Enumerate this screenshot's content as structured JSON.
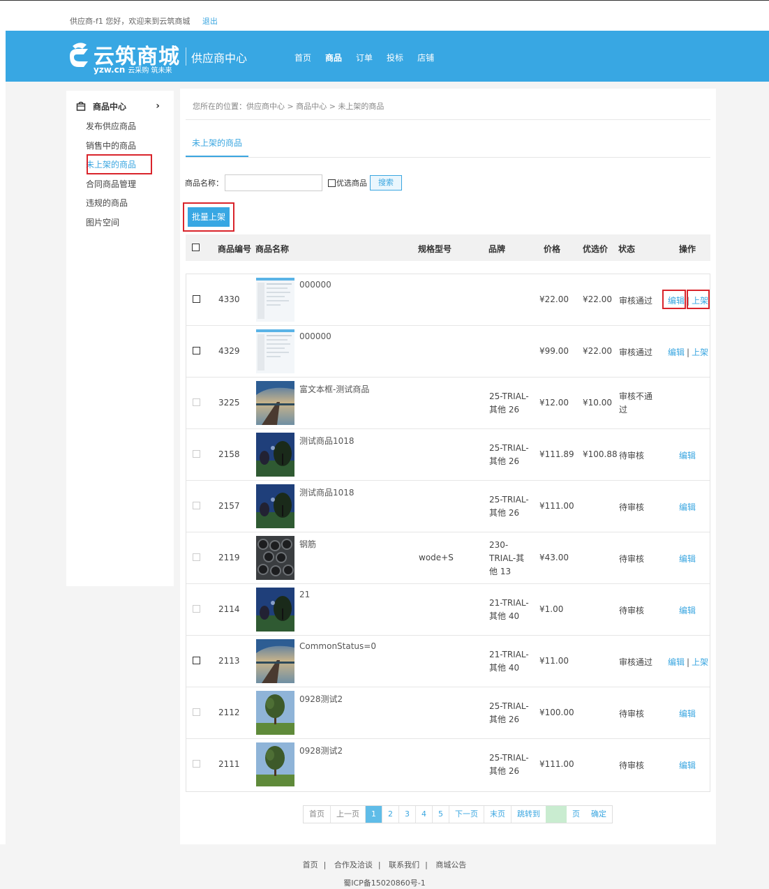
{
  "topbar": {
    "welcome": "供应商-f1 您好，欢迎来到云筑商城",
    "logout": "退出"
  },
  "header": {
    "logo_main": "云筑商城",
    "logo_domain": "yzw.cn",
    "logo_slogan": "云采购 筑未来",
    "title": "供应商中心",
    "nav": [
      "首页",
      "商品",
      "订单",
      "投标",
      "店铺"
    ],
    "brand_color": "#38a7e3"
  },
  "sidebar": {
    "heading": "商品中心",
    "items": [
      "发布供应商品",
      "销售中的商品",
      "未上架的商品",
      "合同商品管理",
      "违规的商品",
      "图片空间"
    ],
    "active_index": 2
  },
  "main": {
    "breadcrumb": "您所在的位置：供应商中心 > 商品中心 > 未上架的商品",
    "tab": "未上架的商品",
    "search": {
      "label": "商品名称：",
      "value": "",
      "checkbox_label": "优选商品",
      "button": "搜索"
    },
    "batch_button": "批量上架",
    "columns": [
      "商品编号",
      "商品名称",
      "规格型号",
      "品牌",
      "价格",
      "优选价",
      "状态",
      "操作"
    ],
    "rows": [
      {
        "id": "4330",
        "name": "000000",
        "spec": "",
        "brand": "",
        "price": "¥22.00",
        "preferred": "¥22.00",
        "status": "审核通过",
        "edit": "编辑",
        "shelf": "上架",
        "thumb": "screenshot",
        "checkable": true
      },
      {
        "id": "4329",
        "name": "000000",
        "spec": "",
        "brand": "",
        "price": "¥99.00",
        "preferred": "¥22.00",
        "status": "审核通过",
        "edit": "编辑",
        "shelf": "上架",
        "thumb": "screenshot",
        "checkable": true
      },
      {
        "id": "3225",
        "name": "富文本框-测试商品",
        "spec": "",
        "brand": "25-TRIAL-其他 26",
        "price": "¥12.00",
        "preferred": "¥10.00",
        "status": "审核不通过",
        "edit": "",
        "shelf": "",
        "thumb": "pier",
        "checkable": false
      },
      {
        "id": "2158",
        "name": "测试商品1018",
        "spec": "",
        "brand": "25-TRIAL-其他 26",
        "price": "¥111.89",
        "preferred": "¥100.88",
        "status": "待审核",
        "edit": "编辑",
        "shelf": "",
        "thumb": "trees",
        "checkable": false
      },
      {
        "id": "2157",
        "name": "测试商品1018",
        "spec": "",
        "brand": "25-TRIAL-其他 26",
        "price": "¥111.00",
        "preferred": "",
        "status": "待审核",
        "edit": "编辑",
        "shelf": "",
        "thumb": "trees",
        "checkable": false
      },
      {
        "id": "2119",
        "name": "钢筋",
        "spec": "wode+S",
        "brand": "230-TRIAL-其他 13",
        "price": "¥43.00",
        "preferred": "",
        "status": "待审核",
        "edit": "编辑",
        "shelf": "",
        "thumb": "pipes",
        "checkable": false
      },
      {
        "id": "2114",
        "name": "21",
        "spec": "",
        "brand": "21-TRIAL-其他 40",
        "price": "¥1.00",
        "preferred": "",
        "status": "待审核",
        "edit": "编辑",
        "shelf": "",
        "thumb": "trees",
        "checkable": false
      },
      {
        "id": "2113",
        "name": "CommonStatus=0",
        "spec": "",
        "brand": "21-TRIAL-其他 40",
        "price": "¥11.00",
        "preferred": "",
        "status": "审核通过",
        "edit": "编辑",
        "shelf": "上架",
        "thumb": "pier",
        "checkable": true
      },
      {
        "id": "2112",
        "name": "0928测试2",
        "spec": "",
        "brand": "25-TRIAL-其他 26",
        "price": "¥100.00",
        "preferred": "",
        "status": "待审核",
        "edit": "编辑",
        "shelf": "",
        "thumb": "tree",
        "checkable": false
      },
      {
        "id": "2111",
        "name": "0928测试2",
        "spec": "",
        "brand": "25-TRIAL-其他 26",
        "price": "¥111.00",
        "preferred": "",
        "status": "待审核",
        "edit": "编辑",
        "shelf": "",
        "thumb": "tree",
        "checkable": false
      }
    ]
  },
  "pager": {
    "first": "首页",
    "prev": "上一页",
    "pages": [
      "1",
      "2",
      "3",
      "4",
      "5"
    ],
    "current": "1",
    "next": "下一页",
    "last": "末页",
    "jump": "跳转到",
    "page_unit": "页",
    "confirm": "确定"
  },
  "footer": {
    "links": [
      "首页",
      "合作及洽谈",
      "联系我们",
      "商城公告"
    ],
    "icp": "蜀ICP备15020860号-1"
  }
}
